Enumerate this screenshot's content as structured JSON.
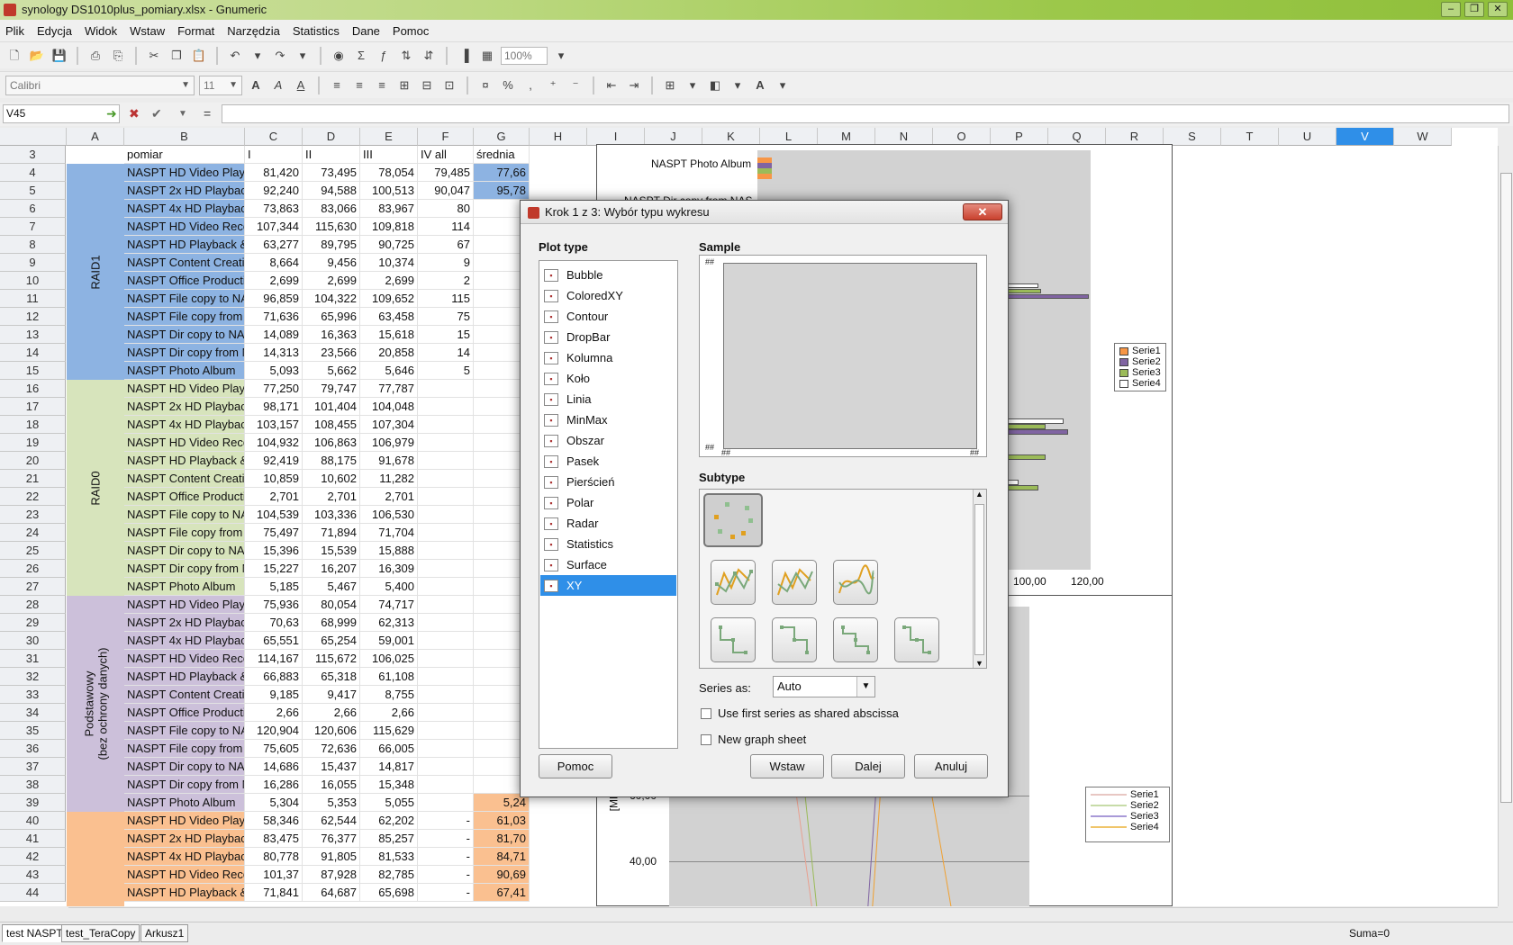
{
  "window": {
    "title": "synology DS1010plus_pomiary.xlsx - Gnumeric"
  },
  "menu": [
    "Plik",
    "Edycja",
    "Widok",
    "Wstaw",
    "Format",
    "Narzędzia",
    "Statistics",
    "Dane",
    "Pomoc"
  ],
  "toolbar": {
    "zoom": "100%",
    "font": "Calibri",
    "size": "11"
  },
  "formula": {
    "cell_ref": "V45",
    "equals": "=",
    "value": ""
  },
  "columns": [
    "A",
    "B",
    "C",
    "D",
    "E",
    "F",
    "G",
    "H",
    "I",
    "J",
    "K",
    "L",
    "M",
    "N",
    "O",
    "P",
    "Q",
    "R",
    "S",
    "T",
    "U",
    "V",
    "W"
  ],
  "selected_column": "V",
  "header_row": {
    "num": "3",
    "b": "pomiar",
    "c": "I",
    "d": "II",
    "e": "III",
    "f": "IV all",
    "g": "średnia"
  },
  "groups": [
    {
      "label": "RAID1",
      "color": "#8db3e2"
    },
    {
      "label": "RAID0",
      "color": "#d7e4bc"
    },
    {
      "label": "Podstawowy\n(bez ochrony danych)",
      "color": "#ccc0da"
    },
    {
      "label": "",
      "color": "#fac090"
    }
  ],
  "rows": [
    {
      "n": "4",
      "b": "NASPT HD Video Playback",
      "c": "81,420",
      "d": "73,495",
      "e": "78,054",
      "f": "79,485",
      "g": "77,66"
    },
    {
      "n": "5",
      "b": "NASPT 2x HD Playback",
      "c": "92,240",
      "d": "94,588",
      "e": "100,513",
      "f": "90,047",
      "g": "95,78"
    },
    {
      "n": "6",
      "b": "NASPT 4x HD Playback",
      "c": "73,863",
      "d": "83,066",
      "e": "83,967",
      "f": "80",
      "g": ""
    },
    {
      "n": "7",
      "b": "NASPT HD Video Record",
      "c": "107,344",
      "d": "115,630",
      "e": "109,818",
      "f": "114",
      "g": ""
    },
    {
      "n": "8",
      "b": "NASPT HD Playback & Record",
      "c": "63,277",
      "d": "89,795",
      "e": "90,725",
      "f": "67",
      "g": ""
    },
    {
      "n": "9",
      "b": "NASPT Content Creation",
      "c": "8,664",
      "d": "9,456",
      "e": "10,374",
      "f": "9",
      "g": ""
    },
    {
      "n": "10",
      "b": "NASPT Office Productivity",
      "c": "2,699",
      "d": "2,699",
      "e": "2,699",
      "f": "2",
      "g": ""
    },
    {
      "n": "11",
      "b": "NASPT File copy to NAS",
      "c": "96,859",
      "d": "104,322",
      "e": "109,652",
      "f": "115",
      "g": ""
    },
    {
      "n": "12",
      "b": "NASPT File copy from NAS",
      "c": "71,636",
      "d": "65,996",
      "e": "63,458",
      "f": "75",
      "g": ""
    },
    {
      "n": "13",
      "b": "NASPT Dir copy to NAS",
      "c": "14,089",
      "d": "16,363",
      "e": "15,618",
      "f": "15",
      "g": ""
    },
    {
      "n": "14",
      "b": "NASPT Dir copy from NAS",
      "c": "14,313",
      "d": "23,566",
      "e": "20,858",
      "f": "14",
      "g": ""
    },
    {
      "n": "15",
      "b": "NASPT Photo Album",
      "c": "5,093",
      "d": "5,662",
      "e": "5,646",
      "f": "5",
      "g": ""
    },
    {
      "n": "16",
      "b": "NASPT HD Video Playback",
      "c": "77,250",
      "d": "79,747",
      "e": "77,787",
      "f": "",
      "g": ""
    },
    {
      "n": "17",
      "b": "NASPT 2x HD Playback",
      "c": "98,171",
      "d": "101,404",
      "e": "104,048",
      "f": "",
      "g": ""
    },
    {
      "n": "18",
      "b": "NASPT 4x HD Playback",
      "c": "103,157",
      "d": "108,455",
      "e": "107,304",
      "f": "",
      "g": ""
    },
    {
      "n": "19",
      "b": "NASPT HD Video Record",
      "c": "104,932",
      "d": "106,863",
      "e": "106,979",
      "f": "",
      "g": ""
    },
    {
      "n": "20",
      "b": "NASPT HD Playback & Record",
      "c": "92,419",
      "d": "88,175",
      "e": "91,678",
      "f": "",
      "g": ""
    },
    {
      "n": "21",
      "b": "NASPT Content Creation",
      "c": "10,859",
      "d": "10,602",
      "e": "11,282",
      "f": "",
      "g": ""
    },
    {
      "n": "22",
      "b": "NASPT Office Productivity",
      "c": "2,701",
      "d": "2,701",
      "e": "2,701",
      "f": "",
      "g": ""
    },
    {
      "n": "23",
      "b": "NASPT File copy to NAS",
      "c": "104,539",
      "d": "103,336",
      "e": "106,530",
      "f": "",
      "g": ""
    },
    {
      "n": "24",
      "b": "NASPT File copy from NAS",
      "c": "75,497",
      "d": "71,894",
      "e": "71,704",
      "f": "",
      "g": ""
    },
    {
      "n": "25",
      "b": "NASPT Dir copy to NAS",
      "c": "15,396",
      "d": "15,539",
      "e": "15,888",
      "f": "",
      "g": ""
    },
    {
      "n": "26",
      "b": "NASPT Dir copy from NAS",
      "c": "15,227",
      "d": "16,207",
      "e": "16,309",
      "f": "",
      "g": ""
    },
    {
      "n": "27",
      "b": "NASPT Photo Album",
      "c": "5,185",
      "d": "5,467",
      "e": "5,400",
      "f": "",
      "g": ""
    },
    {
      "n": "28",
      "b": "NASPT HD Video Playback",
      "c": "75,936",
      "d": "80,054",
      "e": "74,717",
      "f": "",
      "g": ""
    },
    {
      "n": "29",
      "b": "NASPT 2x HD Playback",
      "c": "70,63",
      "d": "68,999",
      "e": "62,313",
      "f": "",
      "g": ""
    },
    {
      "n": "30",
      "b": "NASPT 4x HD Playback",
      "c": "65,551",
      "d": "65,254",
      "e": "59,001",
      "f": "",
      "g": ""
    },
    {
      "n": "31",
      "b": "NASPT HD Video Record",
      "c": "114,167",
      "d": "115,672",
      "e": "106,025",
      "f": "",
      "g": ""
    },
    {
      "n": "32",
      "b": "NASPT HD Playback & Record",
      "c": "66,883",
      "d": "65,318",
      "e": "61,108",
      "f": "",
      "g": ""
    },
    {
      "n": "33",
      "b": "NASPT Content Creation",
      "c": "9,185",
      "d": "9,417",
      "e": "8,755",
      "f": "",
      "g": ""
    },
    {
      "n": "34",
      "b": "NASPT Office Productivity",
      "c": "2,66",
      "d": "2,66",
      "e": "2,66",
      "f": "",
      "g": ""
    },
    {
      "n": "35",
      "b": "NASPT File copy to NAS",
      "c": "120,904",
      "d": "120,606",
      "e": "115,629",
      "f": "",
      "g": ""
    },
    {
      "n": "36",
      "b": "NASPT File copy from NAS",
      "c": "75,605",
      "d": "72,636",
      "e": "66,005",
      "f": "",
      "g": ""
    },
    {
      "n": "37",
      "b": "NASPT Dir copy to NAS",
      "c": "14,686",
      "d": "15,437",
      "e": "14,817",
      "f": "",
      "g": ""
    },
    {
      "n": "38",
      "b": "NASPT Dir copy from NAS",
      "c": "16,286",
      "d": "16,055",
      "e": "15,348",
      "f": "",
      "g": ""
    },
    {
      "n": "39",
      "b": "NASPT Photo Album",
      "c": "5,304",
      "d": "5,353",
      "e": "5,055",
      "f": "",
      "g": "5,24"
    },
    {
      "n": "40",
      "b": "NASPT HD Video Playback",
      "c": "58,346",
      "d": "62,544",
      "e": "62,202",
      "f": "-",
      "g": "61,03"
    },
    {
      "n": "41",
      "b": "NASPT 2x HD Playback",
      "c": "83,475",
      "d": "76,377",
      "e": "85,257",
      "f": "-",
      "g": "81,70"
    },
    {
      "n": "42",
      "b": "NASPT 4x HD Playback",
      "c": "80,778",
      "d": "91,805",
      "e": "81,533",
      "f": "-",
      "g": "84,71"
    },
    {
      "n": "43",
      "b": "NASPT HD Video Record",
      "c": "101,37",
      "d": "87,928",
      "e": "82,785",
      "f": "-",
      "g": "90,69"
    },
    {
      "n": "44",
      "b": "NASPT HD Playback & Record",
      "c": "71,841",
      "d": "64,687",
      "e": "65,698",
      "f": "-",
      "g": "67,41"
    }
  ],
  "chart1": {
    "labels": [
      "NASPT Photo Album",
      "NASPT Dir copy from NAS"
    ],
    "ticks": [
      "100,00",
      "120,00"
    ],
    "legend": [
      "Serie1",
      "Serie2",
      "Serie3",
      "Serie4"
    ],
    "colors": [
      "#f79646",
      "#8064a2",
      "#9bbb59",
      "#ffffff"
    ]
  },
  "chart2": {
    "axis_label": "[MB/",
    "ticks": [
      "60,00",
      "40,00"
    ],
    "legend": [
      "Serie1",
      "Serie2",
      "Serie3",
      "Serie4"
    ],
    "colors": [
      "#e8c7c3",
      "#c7dca8",
      "#a99ad8",
      "#f0c56a"
    ]
  },
  "dialog": {
    "title": "Krok 1 z 3: Wybór typu wykresu",
    "plot_type_label": "Plot type",
    "sample_label": "Sample",
    "subtype_label": "Subtype",
    "plot_types": [
      "Bubble",
      "ColoredXY",
      "Contour",
      "DropBar",
      "Kolumna",
      "Koło",
      "Linia",
      "MinMax",
      "Obszar",
      "Pasek",
      "Pierścień",
      "Polar",
      "Radar",
      "Statistics",
      "Surface",
      "XY"
    ],
    "selected": "XY",
    "series_as_label": "Series as:",
    "series_as_value": "Auto",
    "shared_abscissa": "Use first series as shared abscissa",
    "new_graph_sheet": "New graph sheet",
    "btn_help": "Pomoc",
    "btn_insert": "Wstaw",
    "btn_next": "Dalej",
    "btn_cancel": "Anuluj",
    "close": "✕",
    "placeholder": "##"
  },
  "sheets": [
    "test NASPT",
    "test_TeraCopy",
    "Arkusz1"
  ],
  "active_sheet": "test NASPT",
  "status": {
    "sum": "Suma=0"
  }
}
